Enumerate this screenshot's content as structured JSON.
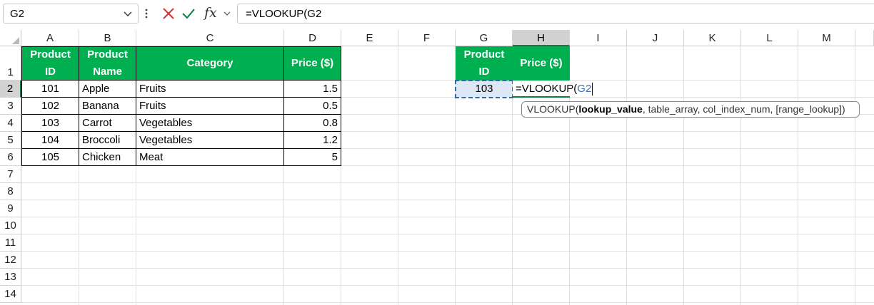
{
  "formula_bar": {
    "name_box": "G2",
    "cancel_icon": "close-icon",
    "enter_icon": "checkmark-icon",
    "fx_label": "fx",
    "formula": "=VLOOKUP(G2"
  },
  "columns": [
    "A",
    "B",
    "C",
    "D",
    "E",
    "F",
    "G",
    "H",
    "I",
    "J",
    "K",
    "L",
    "M"
  ],
  "active_column": "H",
  "rows": [
    "1",
    "2",
    "3",
    "4",
    "5",
    "6",
    "7",
    "8",
    "9",
    "10",
    "11",
    "12",
    "13",
    "14"
  ],
  "active_row": "2",
  "product_table": {
    "headers": [
      "Product ID",
      "Product Name",
      "Category",
      "Price ($)"
    ],
    "rows": [
      [
        "101",
        "Apple",
        "Fruits",
        "1.5"
      ],
      [
        "102",
        "Banana",
        "Fruits",
        "0.5"
      ],
      [
        "103",
        "Carrot",
        "Vegetables",
        "0.8"
      ],
      [
        "104",
        "Broccoli",
        "Vegetables",
        "1.2"
      ],
      [
        "105",
        "Chicken",
        "Meat",
        "5"
      ]
    ]
  },
  "lookup_table": {
    "headers": [
      "Product ID",
      "Price ($)"
    ],
    "lookup_value": "103",
    "editing_prefix": "=VLOOKUP(",
    "editing_ref": "G2"
  },
  "tooltip": {
    "func": "VLOOKUP(",
    "arg_bold": "lookup_value",
    "rest": ", table_array, col_index_num, [range_lookup])"
  },
  "colors": {
    "header_fill": "#00b050",
    "header_text": "#ffffff",
    "selection": "#107c41",
    "ref_color": "#3d6dad"
  }
}
